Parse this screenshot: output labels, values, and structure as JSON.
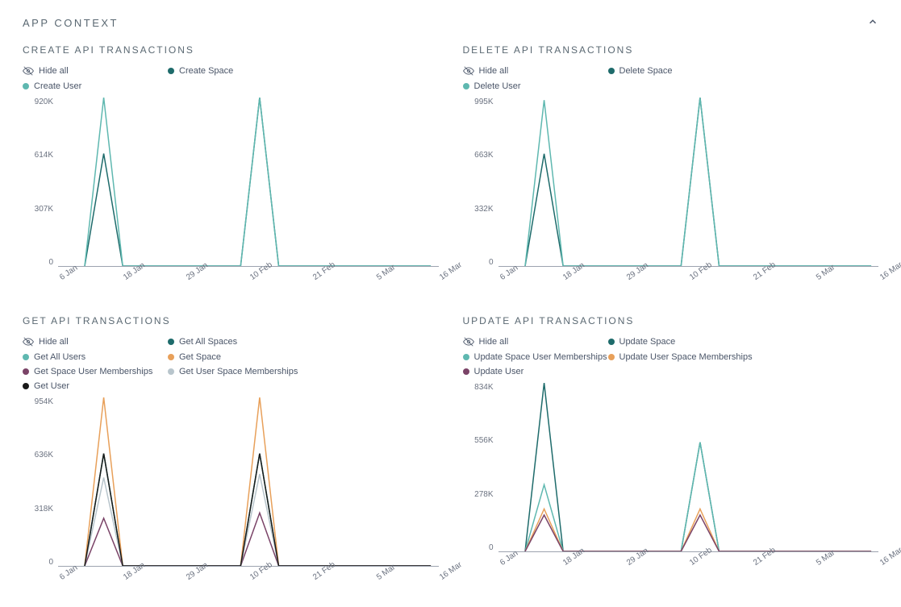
{
  "section": {
    "title": "APP CONTEXT"
  },
  "colors": {
    "teal_dark": "#1e6b6b",
    "teal_light": "#5fb8b0",
    "orange": "#e8a05a",
    "plum": "#7a4367",
    "gray_light": "#b8c5cc",
    "near_black": "#1a1a1a"
  },
  "x_ticks": [
    "6 Jan",
    "18 Jan",
    "29 Jan",
    "10 Feb",
    "21 Feb",
    "5 Mar",
    "16 Mar"
  ],
  "hide_all_label": "Hide all",
  "charts": [
    {
      "id": "create",
      "title": "CREATE API TRANSACTIONS",
      "y_ticks": [
        "920K",
        "614K",
        "307K",
        "0"
      ],
      "legend": [
        {
          "label": "Create Space",
          "color": "teal_dark"
        },
        {
          "label": "Create User",
          "color": "teal_light"
        }
      ]
    },
    {
      "id": "delete",
      "title": "DELETE API TRANSACTIONS",
      "y_ticks": [
        "995K",
        "663K",
        "332K",
        "0"
      ],
      "legend": [
        {
          "label": "Delete Space",
          "color": "teal_dark"
        },
        {
          "label": "Delete User",
          "color": "teal_light"
        }
      ]
    },
    {
      "id": "get",
      "title": "GET API TRANSACTIONS",
      "y_ticks": [
        "954K",
        "636K",
        "318K",
        "0"
      ],
      "legend": [
        {
          "label": "Get All Spaces",
          "color": "teal_dark"
        },
        {
          "label": "Get All Users",
          "color": "teal_light"
        },
        {
          "label": "Get Space",
          "color": "orange"
        },
        {
          "label": "Get Space User Memberships",
          "color": "plum"
        },
        {
          "label": "Get User Space Memberships",
          "color": "gray_light"
        },
        {
          "label": "Get User",
          "color": "near_black"
        }
      ]
    },
    {
      "id": "update",
      "title": "UPDATE API TRANSACTIONS",
      "y_ticks": [
        "834K",
        "556K",
        "278K",
        "0"
      ],
      "legend": [
        {
          "label": "Update Space",
          "color": "teal_dark"
        },
        {
          "label": "Update Space User Memberships",
          "color": "teal_light"
        },
        {
          "label": "Update User Space Memberships",
          "color": "orange"
        },
        {
          "label": "Update User",
          "color": "plum"
        }
      ]
    }
  ],
  "chart_data": [
    {
      "type": "line",
      "title": "CREATE API TRANSACTIONS",
      "xlabel": "",
      "ylabel": "",
      "ylim": [
        0,
        920000
      ],
      "x": [
        "6 Jan",
        "8 Jan",
        "10 Jan",
        "18 Jan",
        "29 Jan",
        "8 Feb",
        "10 Feb",
        "12 Feb",
        "21 Feb",
        "5 Mar",
        "16 Mar"
      ],
      "series": [
        {
          "name": "Create Space",
          "values": [
            0,
            614000,
            0,
            0,
            0,
            0,
            920000,
            0,
            0,
            0,
            0
          ]
        },
        {
          "name": "Create User",
          "values": [
            0,
            920000,
            0,
            0,
            0,
            0,
            920000,
            0,
            0,
            0,
            0
          ]
        }
      ]
    },
    {
      "type": "line",
      "title": "DELETE API TRANSACTIONS",
      "xlabel": "",
      "ylabel": "",
      "ylim": [
        0,
        995000
      ],
      "x": [
        "6 Jan",
        "8 Jan",
        "10 Jan",
        "18 Jan",
        "29 Jan",
        "8 Feb",
        "10 Feb",
        "12 Feb",
        "21 Feb",
        "5 Mar",
        "16 Mar"
      ],
      "series": [
        {
          "name": "Delete Space",
          "values": [
            0,
            663000,
            0,
            0,
            0,
            0,
            995000,
            0,
            0,
            0,
            0
          ]
        },
        {
          "name": "Delete User",
          "values": [
            0,
            980000,
            0,
            0,
            0,
            0,
            995000,
            0,
            0,
            0,
            0
          ]
        }
      ]
    },
    {
      "type": "line",
      "title": "GET API TRANSACTIONS",
      "xlabel": "",
      "ylabel": "",
      "ylim": [
        0,
        954000
      ],
      "x": [
        "6 Jan",
        "8 Jan",
        "10 Jan",
        "18 Jan",
        "29 Jan",
        "8 Feb",
        "10 Feb",
        "12 Feb",
        "21 Feb",
        "5 Mar",
        "16 Mar"
      ],
      "series": [
        {
          "name": "Get All Spaces",
          "values": [
            0,
            636000,
            0,
            0,
            0,
            0,
            636000,
            0,
            0,
            0,
            0
          ]
        },
        {
          "name": "Get All Users",
          "values": [
            0,
            636000,
            0,
            0,
            0,
            0,
            636000,
            0,
            0,
            0,
            0
          ]
        },
        {
          "name": "Get Space",
          "values": [
            0,
            954000,
            0,
            0,
            0,
            0,
            954000,
            0,
            0,
            0,
            0
          ]
        },
        {
          "name": "Get Space User Memberships",
          "values": [
            0,
            270000,
            0,
            0,
            0,
            0,
            300000,
            0,
            0,
            0,
            0
          ]
        },
        {
          "name": "Get User Space Memberships",
          "values": [
            0,
            500000,
            0,
            0,
            0,
            0,
            520000,
            0,
            0,
            0,
            0
          ]
        },
        {
          "name": "Get User",
          "values": [
            0,
            636000,
            0,
            0,
            0,
            0,
            636000,
            0,
            0,
            0,
            0
          ]
        }
      ]
    },
    {
      "type": "line",
      "title": "UPDATE API TRANSACTIONS",
      "xlabel": "",
      "ylabel": "",
      "ylim": [
        0,
        834000
      ],
      "x": [
        "6 Jan",
        "8 Jan",
        "10 Jan",
        "18 Jan",
        "29 Jan",
        "8 Feb",
        "10 Feb",
        "12 Feb",
        "21 Feb",
        "5 Mar",
        "16 Mar"
      ],
      "series": [
        {
          "name": "Update Space",
          "values": [
            0,
            834000,
            0,
            0,
            0,
            0,
            540000,
            0,
            0,
            0,
            0
          ]
        },
        {
          "name": "Update Space User Memberships",
          "values": [
            0,
            330000,
            0,
            0,
            0,
            0,
            540000,
            0,
            0,
            0,
            0
          ]
        },
        {
          "name": "Update User Space Memberships",
          "values": [
            0,
            210000,
            0,
            0,
            0,
            0,
            210000,
            0,
            0,
            0,
            0
          ]
        },
        {
          "name": "Update User",
          "values": [
            0,
            180000,
            0,
            0,
            0,
            0,
            180000,
            0,
            0,
            0,
            0
          ]
        }
      ]
    }
  ]
}
